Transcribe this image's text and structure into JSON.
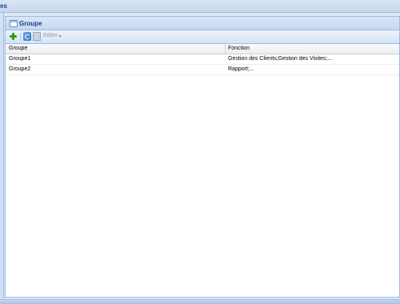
{
  "window": {
    "title": "es"
  },
  "panel": {
    "title": "Groupe"
  },
  "toolbar": {
    "edit_label": "Editer"
  },
  "grid": {
    "columns": [
      "Groupe",
      "Fonction"
    ],
    "rows": [
      {
        "groupe": "Groupe1",
        "fonction": "Gestion des Clients;Gestion des Visites;..."
      },
      {
        "groupe": "Groupe2",
        "fonction": "Rapport;..."
      }
    ]
  },
  "colors": {
    "header_bg": "#c7d7ed",
    "title_text": "#15428b",
    "border": "#99bbe8",
    "add_icon": "#2f9e1f"
  },
  "icons": [
    "add-icon",
    "refresh-icon",
    "edit-icon",
    "chevron-down-icon",
    "panel-icon"
  ]
}
